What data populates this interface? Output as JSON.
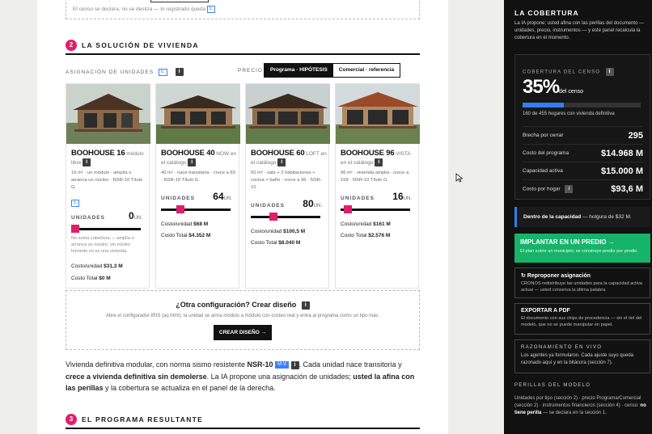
{
  "top_fragment": {
    "text": "El censo se declara, no se desliza — lo registrado queda"
  },
  "section2": {
    "number": "2",
    "title": "LA SOLUCIÓN DE VIVIENDA"
  },
  "allocation": {
    "label": "ASIGNACIÓN DE UNIDADES",
    "edit_badge": "E",
    "info": "i"
  },
  "price": {
    "label": "PRECIO",
    "options": [
      "Programa · HIPÓTESIS",
      "Comercial · referencia"
    ]
  },
  "cards": [
    {
      "name": "BOOHOUSE 16",
      "tag": "módulo libre",
      "desc": "16 m² · un módulo · amplía o arranca un núcleo · NSR-10 Título G",
      "edit_badge": "E",
      "units_label": "UNIDADES",
      "units": "0",
      "unit_suffix": "UN.",
      "slider_level": 0,
      "note": "No suma cobertura — amplía o arranca un núcleo; sin núcleo húmedo no es una vivienda.",
      "cost_unit_label": "Costo/unidad",
      "cost_unit": "$31,3 M",
      "cost_total_label": "Costo Total",
      "cost_total": "$0 M"
    },
    {
      "name": "BOOHOUSE 40",
      "tag": "NOW en el catálogo",
      "desc": "40 m² · nace transitoria · crece a 60 · NSR-10 Título G",
      "units_label": "UNIDADES",
      "units": "64",
      "unit_suffix": "UN.",
      "slider_level": 0.25,
      "cost_unit_label": "Costo/unidad",
      "cost_unit": "$68 M",
      "cost_total_label": "Costo Total",
      "cost_total": "$4.352 M"
    },
    {
      "name": "BOOHOUSE 60",
      "tag": "LOFT en el catálogo",
      "desc": "60 m² · sala + 2 habitaciones + cocina + baño · crece a 96 · NSR-10",
      "units_label": "UNIDADES",
      "units": "80",
      "unit_suffix": "UN.",
      "slider_level": 0.3,
      "cost_unit_label": "Costo/unidad",
      "cost_unit": "$100,5 M",
      "cost_total_label": "Costo Total",
      "cost_total": "$8.040 M"
    },
    {
      "name": "BOOHOUSE 96",
      "tag": "VISTA en el catálogo",
      "desc": "96 m² · vivienda amplia · crece a 168 · NSR-10 Título G",
      "units_label": "UNIDADES",
      "units": "16",
      "unit_suffix": "UN.",
      "slider_level": 0.05,
      "cost_unit_label": "Costo/unidad",
      "cost_unit": "$161 M",
      "cost_total_label": "Costo Total",
      "cost_total": "$2.576 M"
    }
  ],
  "other_config": {
    "title": "¿Otra configuración? Crear diseño",
    "subtitle": "Abre el configurador IRIS (ao.html): la unidad se arma módulo a módulo con costeo real y entra al programa como un tipo más.",
    "button": "CREAR DISEÑO →"
  },
  "paragraph": {
    "p1": "Vivienda definitiva modular, con norma sismo resistente ",
    "nsr": "NSR-10",
    "badge": "M·V",
    "p2": ". Cada unidad nace transitoria y ",
    "bold1": "crece a vivienda definitiva sin demolerse",
    "p3": ". La IA propone una asignación de unidades; ",
    "bold2": "usted la afina con las perillas",
    "p4": " y la cobertura se actualiza en el panel de la derecha."
  },
  "section3": {
    "number": "3",
    "title": "EL PROGRAMA RESULTANTE"
  },
  "sidebar": {
    "title": "LA COBERTURA",
    "intro": "La IA propone; usted afina con las perillas del documento — unidades, precio, instrumentos — y este panel recalcula la cobertura en el momento.",
    "coverage_label": "COBERTURA DEL CENSO",
    "coverage_pct": "35%",
    "coverage_fraction": 0.35,
    "coverage_suffix": "del censo",
    "coverage_detail": "160 de 455 hogares con vivienda definitiva",
    "rows": [
      {
        "label": "Brecha por cerrar",
        "value": "295"
      },
      {
        "label": "Costo del programa",
        "value": "$14.968 M"
      },
      {
        "label": "Capacidad activa",
        "value": "$15.000 M"
      },
      {
        "label": "Costo por hogar",
        "value": "$93,6 M"
      }
    ],
    "callout_bold": "Dentro de la capacidad",
    "callout_text": " — holgura de $32 M.",
    "cta_title": "IMPLANTAR EN UN PREDIO →",
    "cta_sub": "El plan sobre un municipio; se construye predio por predio.",
    "repropose_title": "↻ Reproponer asignación",
    "repropose_sub": "CRONOS redistribuye las unidades para la capacidad activa actual — usted conserva la última palabra.",
    "export_title": "EXPORTAR A PDF",
    "export_sub": "El documento con sus chips de procedencia — sin el riel del modelo, que no se puede manipular en papel.",
    "reasoning_title": "RAZONAMIENTO EN VIVO",
    "reasoning_text": "Los agentes ya formularon. Cada ajuste suyo queda razonado aquí y en la bitácora (sección 7).",
    "knobs_title": "PERILLAS DEL MODELO",
    "knobs_p1": "Unidades por tipo (sección 2) · precio Programa/Comercial (sección 2) · instrumentos financieros (sección 4) · censo: ",
    "knobs_bold": "no tiene perilla",
    "knobs_p2": " — se declara en la sección 1."
  }
}
